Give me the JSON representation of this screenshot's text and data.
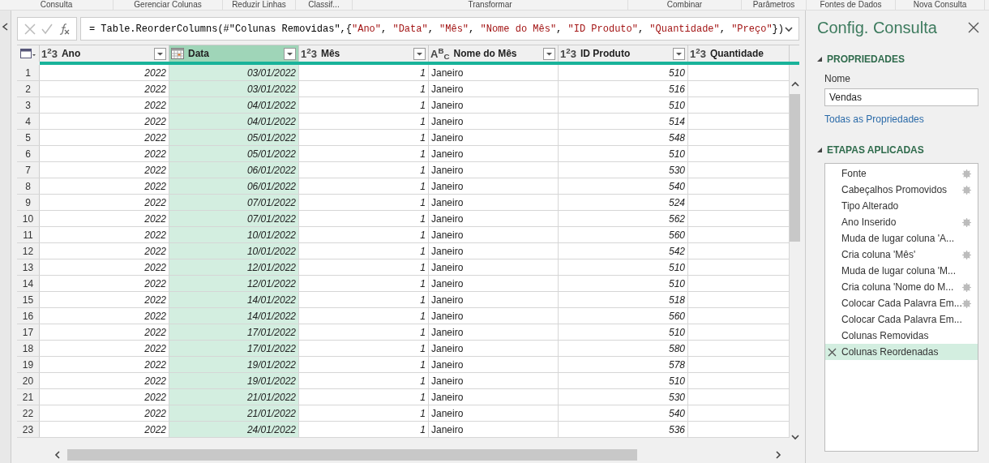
{
  "ribbon_groups": [
    "Consulta",
    "Gerenciar Colunas",
    "Reduzir Linhas",
    "Classif...",
    "Transformar",
    "Combinar",
    "Parâmetros",
    "Fontes de Dados",
    "Nova Consulta"
  ],
  "formula": [
    {
      "kind": "plain",
      "text": "= Table.ReorderColumns(#\"Colunas Removidas\",{"
    },
    {
      "kind": "string",
      "text": "\"Ano\""
    },
    {
      "kind": "plain",
      "text": ", "
    },
    {
      "kind": "string",
      "text": "\"Data\""
    },
    {
      "kind": "plain",
      "text": ", "
    },
    {
      "kind": "string",
      "text": "\"Mês\""
    },
    {
      "kind": "plain",
      "text": ", "
    },
    {
      "kind": "string",
      "text": "\"Nome do Mês\""
    },
    {
      "kind": "plain",
      "text": ", "
    },
    {
      "kind": "string",
      "text": "\"ID Produto\""
    },
    {
      "kind": "plain",
      "text": ", "
    },
    {
      "kind": "string",
      "text": "\"Quantidade\""
    },
    {
      "kind": "plain",
      "text": ", "
    },
    {
      "kind": "string",
      "text": "\"Preço\""
    },
    {
      "kind": "plain",
      "text": "})"
    }
  ],
  "table": {
    "columns": [
      {
        "name": "Ano",
        "kind": "number",
        "type_mark": "1$^{2}$3",
        "selected": false
      },
      {
        "name": "Data",
        "kind": "date",
        "selected": true
      },
      {
        "name": "Mês",
        "kind": "number",
        "type_mark": "1$^{2}$3",
        "selected": false
      },
      {
        "name": "Nome do Mês",
        "kind": "text",
        "type_mark": "A$^{B}$$_{C}$",
        "selected": false
      },
      {
        "name": "ID Produto",
        "kind": "number",
        "type_mark": "1$^{2}$3",
        "selected": false
      },
      {
        "name": "Quantidade",
        "kind": "number",
        "type_mark": "1$^{2}$3",
        "selected": false
      }
    ],
    "rows": [
      {
        "n": "1",
        "cells": [
          "2022",
          "03/01/2022",
          "1",
          "Janeiro",
          "510"
        ]
      },
      {
        "n": "2",
        "cells": [
          "2022",
          "03/01/2022",
          "1",
          "Janeiro",
          "516"
        ]
      },
      {
        "n": "3",
        "cells": [
          "2022",
          "04/01/2022",
          "1",
          "Janeiro",
          "510"
        ]
      },
      {
        "n": "4",
        "cells": [
          "2022",
          "04/01/2022",
          "1",
          "Janeiro",
          "514"
        ]
      },
      {
        "n": "5",
        "cells": [
          "2022",
          "05/01/2022",
          "1",
          "Janeiro",
          "548"
        ]
      },
      {
        "n": "6",
        "cells": [
          "2022",
          "05/01/2022",
          "1",
          "Janeiro",
          "510"
        ]
      },
      {
        "n": "7",
        "cells": [
          "2022",
          "06/01/2022",
          "1",
          "Janeiro",
          "530"
        ]
      },
      {
        "n": "8",
        "cells": [
          "2022",
          "06/01/2022",
          "1",
          "Janeiro",
          "540"
        ]
      },
      {
        "n": "9",
        "cells": [
          "2022",
          "07/01/2022",
          "1",
          "Janeiro",
          "524"
        ]
      },
      {
        "n": "10",
        "cells": [
          "2022",
          "07/01/2022",
          "1",
          "Janeiro",
          "562"
        ]
      },
      {
        "n": "11",
        "cells": [
          "2022",
          "10/01/2022",
          "1",
          "Janeiro",
          "560"
        ]
      },
      {
        "n": "12",
        "cells": [
          "2022",
          "10/01/2022",
          "1",
          "Janeiro",
          "542"
        ]
      },
      {
        "n": "13",
        "cells": [
          "2022",
          "12/01/2022",
          "1",
          "Janeiro",
          "510"
        ]
      },
      {
        "n": "14",
        "cells": [
          "2022",
          "12/01/2022",
          "1",
          "Janeiro",
          "510"
        ]
      },
      {
        "n": "15",
        "cells": [
          "2022",
          "14/01/2022",
          "1",
          "Janeiro",
          "518"
        ]
      },
      {
        "n": "16",
        "cells": [
          "2022",
          "14/01/2022",
          "1",
          "Janeiro",
          "560"
        ]
      },
      {
        "n": "17",
        "cells": [
          "2022",
          "17/01/2022",
          "1",
          "Janeiro",
          "510"
        ]
      },
      {
        "n": "18",
        "cells": [
          "2022",
          "17/01/2022",
          "1",
          "Janeiro",
          "580"
        ]
      },
      {
        "n": "19",
        "cells": [
          "2022",
          "19/01/2022",
          "1",
          "Janeiro",
          "578"
        ]
      },
      {
        "n": "20",
        "cells": [
          "2022",
          "19/01/2022",
          "1",
          "Janeiro",
          "510"
        ]
      },
      {
        "n": "21",
        "cells": [
          "2022",
          "21/01/2022",
          "1",
          "Janeiro",
          "530"
        ]
      },
      {
        "n": "22",
        "cells": [
          "2022",
          "21/01/2022",
          "1",
          "Janeiro",
          "540"
        ]
      },
      {
        "n": "23",
        "cells": [
          "2022",
          "24/01/2022",
          "1",
          "Janeiro",
          "536"
        ]
      }
    ]
  },
  "query_settings": {
    "title": "Config. Consulta",
    "properties_heading": "PROPRIEDADES",
    "name_label": "Nome",
    "name_value": "Vendas",
    "all_properties_link": "Todas as Propriedades",
    "steps_heading": "ETAPAS APLICADAS",
    "steps": [
      {
        "label": "Fonte",
        "has_settings": true,
        "selected": false
      },
      {
        "label": "Cabeçalhos Promovidos",
        "has_settings": true,
        "selected": false
      },
      {
        "label": "Tipo Alterado",
        "has_settings": false,
        "selected": false
      },
      {
        "label": "Ano Inserido",
        "has_settings": true,
        "selected": false
      },
      {
        "label": "Muda de lugar coluna 'A...",
        "has_settings": false,
        "selected": false
      },
      {
        "label": "Cria coluna 'Mês'",
        "has_settings": true,
        "selected": false
      },
      {
        "label": "Muda de lugar coluna 'M...",
        "has_settings": false,
        "selected": false
      },
      {
        "label": "Cria coluna 'Nome do M...",
        "has_settings": true,
        "selected": false
      },
      {
        "label": "Colocar Cada Palavra Em...",
        "has_settings": true,
        "selected": false
      },
      {
        "label": "Colocar Cada Palavra Em...",
        "has_settings": false,
        "selected": false
      },
      {
        "label": "Colunas Removidas",
        "has_settings": false,
        "selected": false
      },
      {
        "label": "Colunas Reordenadas",
        "has_settings": false,
        "selected": true
      }
    ]
  }
}
